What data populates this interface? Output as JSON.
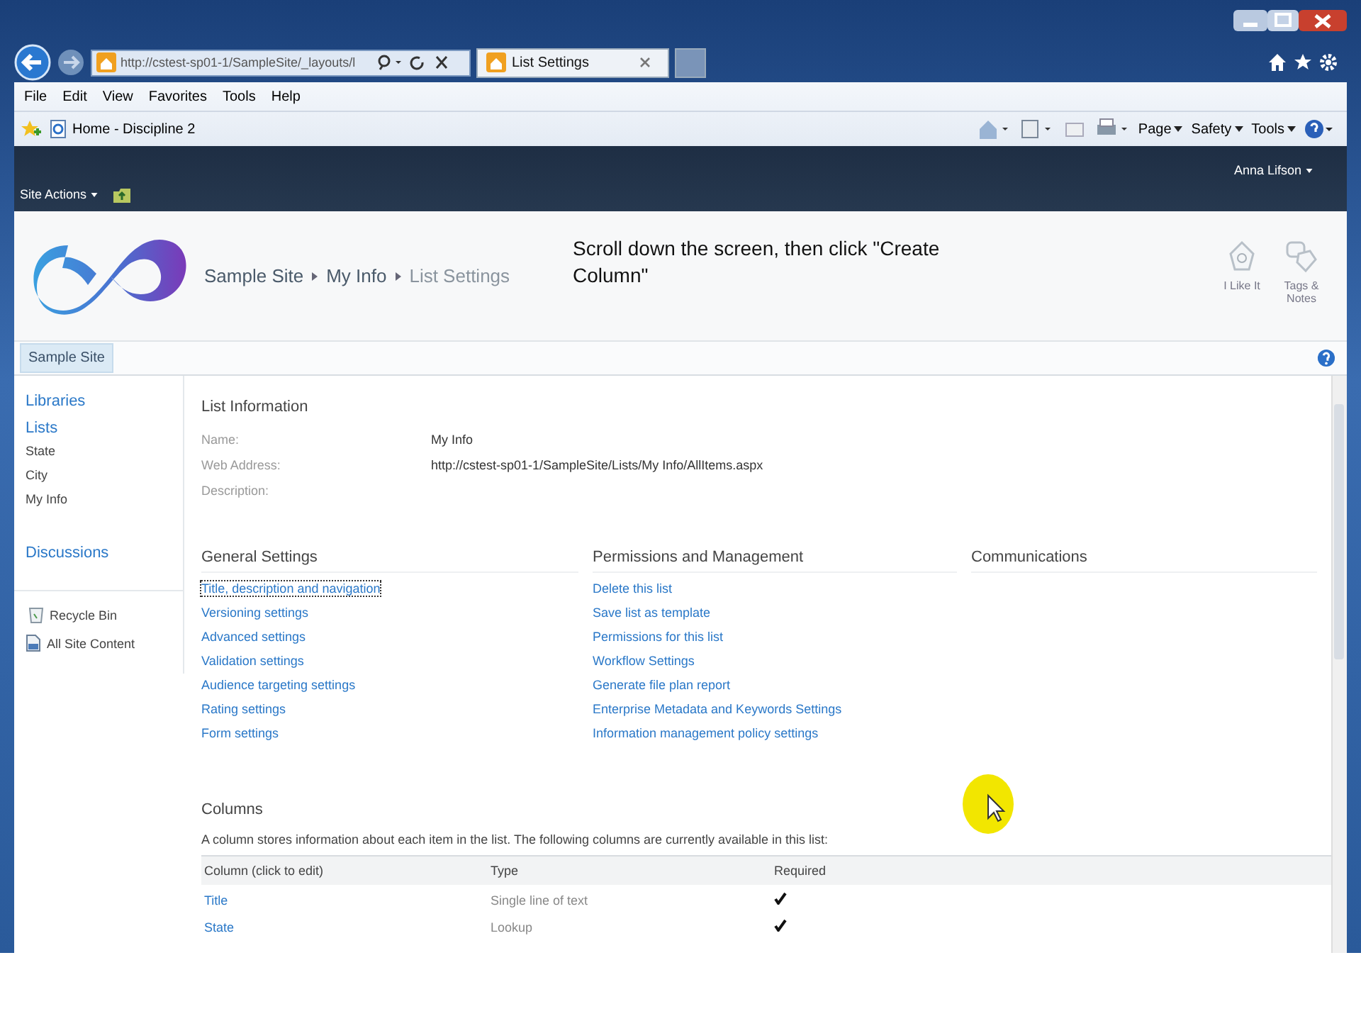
{
  "browser": {
    "address": "http://cstest-sp01-1/SampleSite/_layouts/l",
    "tabs": [
      {
        "label": "List Settings",
        "selected": true
      }
    ],
    "menu": [
      "File",
      "Edit",
      "View",
      "Favorites",
      "Tools",
      "Help"
    ],
    "favorite": "Home - Discipline 2",
    "command_menus": [
      "Page",
      "Safety",
      "Tools"
    ]
  },
  "ribbon": {
    "site_actions": "Site Actions",
    "user": "Anna Lifson"
  },
  "header": {
    "breadcrumb": [
      {
        "label": "Sample Site",
        "current": false
      },
      {
        "label": "My Info",
        "current": false
      },
      {
        "label": "List Settings",
        "current": true
      }
    ],
    "note": "Scroll down the screen, then click \"Create Column\"",
    "actions": [
      {
        "kind": "like",
        "label": "I Like It"
      },
      {
        "kind": "tags",
        "label": "Tags & Notes"
      }
    ]
  },
  "top_nav": [
    {
      "label": "Sample Site",
      "selected": true
    }
  ],
  "left_nav": [
    {
      "kind": "heading",
      "label": "Libraries"
    },
    {
      "kind": "heading",
      "label": "Lists"
    },
    {
      "kind": "item",
      "label": "State"
    },
    {
      "kind": "item",
      "label": "City"
    },
    {
      "kind": "item",
      "label": "My Info"
    },
    {
      "kind": "heading",
      "label": "Discussions"
    },
    {
      "kind": "recycle",
      "label": "Recycle Bin"
    },
    {
      "kind": "content",
      "label": "All Site Content"
    }
  ],
  "list_information": {
    "title": "List Information",
    "fields": [
      {
        "label": "Name:",
        "value": "My Info"
      },
      {
        "label": "Web Address:",
        "value": "http://cstest-sp01-1/SampleSite/Lists/My Info/AllItems.aspx"
      },
      {
        "label": "Description:"
      }
    ]
  },
  "sections": [
    {
      "title": "General Settings",
      "links": [
        {
          "label": "Title, description and navigation",
          "focused": true
        },
        {
          "label": "Versioning settings",
          "focused": false
        },
        {
          "label": "Advanced settings",
          "focused": false
        },
        {
          "label": "Validation settings",
          "focused": false
        },
        {
          "label": "Audience targeting settings",
          "focused": false
        },
        {
          "label": "Rating settings",
          "focused": false
        },
        {
          "label": "Form settings",
          "focused": false
        }
      ]
    },
    {
      "title": "Permissions and Management",
      "links": [
        {
          "label": "Delete this list",
          "focused": false
        },
        {
          "label": "Save list as template",
          "focused": false
        },
        {
          "label": "Permissions for this list",
          "focused": false
        },
        {
          "label": "Workflow Settings",
          "focused": false
        },
        {
          "label": "Generate file plan report",
          "focused": false
        },
        {
          "label": "Enterprise Metadata and Keywords Settings",
          "focused": false
        },
        {
          "label": "Information management policy settings",
          "focused": false
        }
      ]
    },
    {
      "title": "Communications"
    }
  ],
  "columns": {
    "title": "Columns",
    "description": "A column stores information about each item in the list. The following columns are currently available in this list:",
    "headers": [
      "Column (click to edit)",
      "Type",
      "Required"
    ],
    "rows": [
      {
        "name": "Title",
        "type": "Single line of text",
        "required": true
      },
      {
        "name": "State",
        "type": "Lookup",
        "required": true
      }
    ]
  }
}
